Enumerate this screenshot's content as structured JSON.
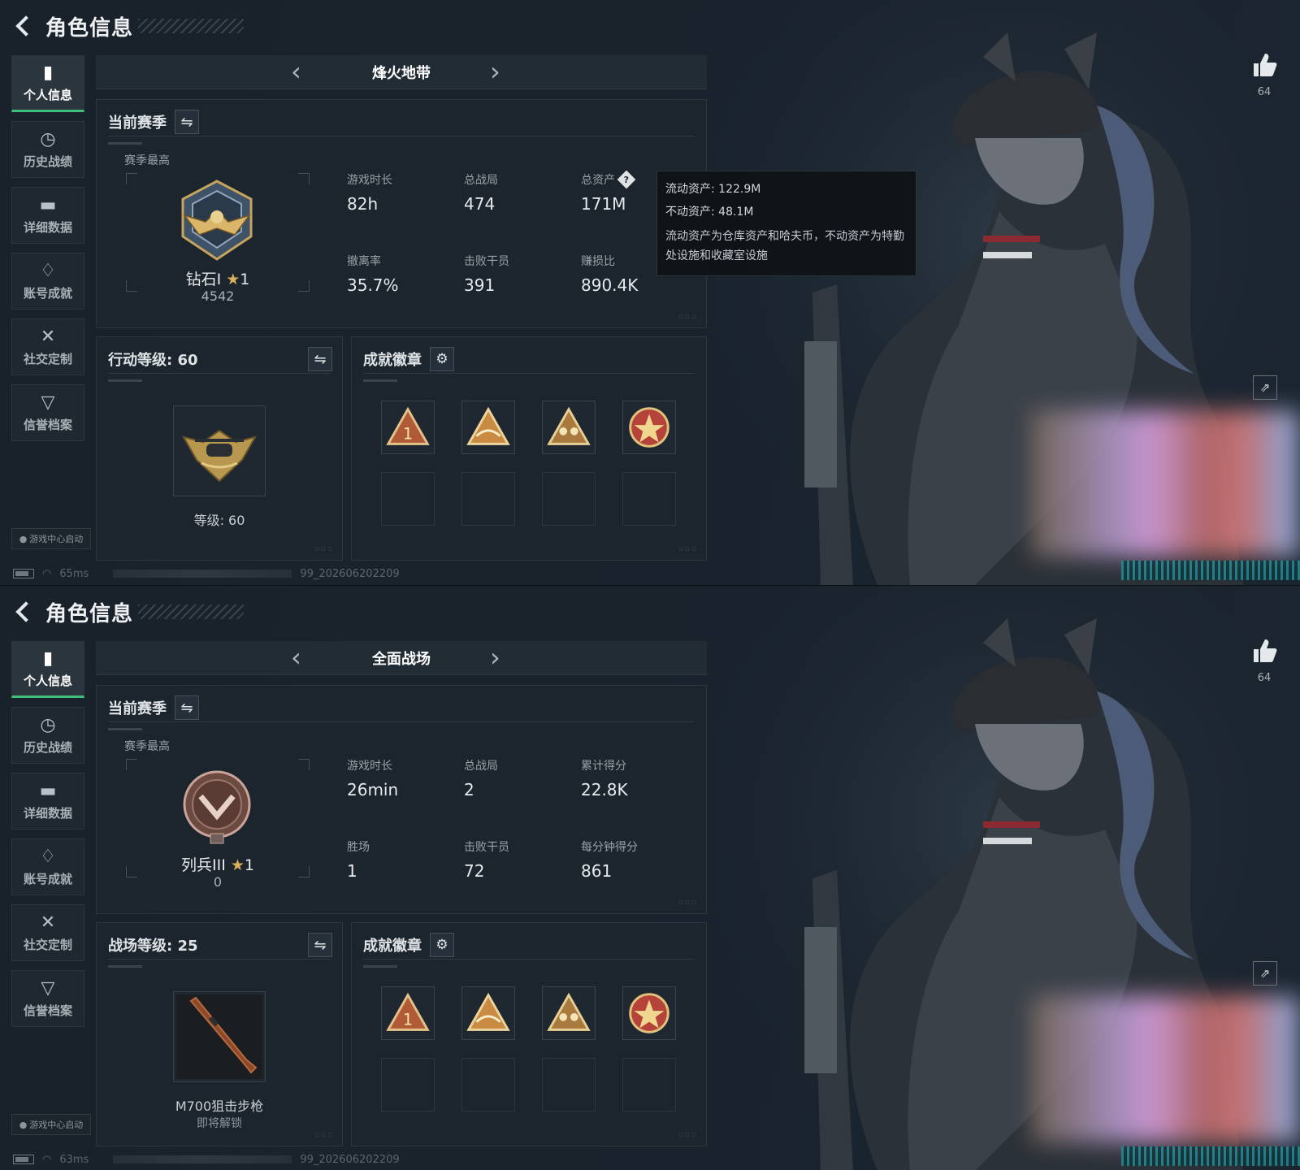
{
  "screens": [
    {
      "header": {
        "title": "角色信息"
      },
      "nav": [
        {
          "label": "个人信息",
          "icon": "bar-chart-icon"
        },
        {
          "label": "历史战绩",
          "icon": "clock-icon"
        },
        {
          "label": "详细数据",
          "icon": "folder-icon"
        },
        {
          "label": "账号成就",
          "icon": "trophy-icon"
        },
        {
          "label": "社交定制",
          "icon": "tools-icon"
        },
        {
          "label": "信誉档案",
          "icon": "shield-icon"
        }
      ],
      "launch_label": "游戏中心启动",
      "status": {
        "ping": "65ms",
        "version": "99_202606202209"
      },
      "mode": "烽火地带",
      "season": {
        "title": "当前赛季",
        "best_label": "赛季最高",
        "rank_name": "钻石I",
        "rank_stars": "1",
        "rank_points": "4542",
        "stats": [
          {
            "key": "游戏时长",
            "value": "82h"
          },
          {
            "key": "总战局",
            "value": "474"
          },
          {
            "key": "总资产",
            "value": "171M",
            "help": "?"
          },
          {
            "key": "撤离率",
            "value": "35.7%"
          },
          {
            "key": "击败干员",
            "value": "391"
          },
          {
            "key": "赚损比",
            "value": "890.4K"
          }
        ]
      },
      "level": {
        "title": "行动等级: 60",
        "caption": "等级: 60",
        "sub": ""
      },
      "achievements": {
        "title": "成就徽章"
      },
      "tooltip": {
        "line1": "流动资产: 122.9M",
        "line2": "不动资产: 48.1M",
        "note": "流动资产为仓库资产和哈夫币，不动资产为特勤处设施和收藏室设施"
      },
      "likes": "64"
    },
    {
      "header": {
        "title": "角色信息"
      },
      "nav": [
        {
          "label": "个人信息",
          "icon": "bar-chart-icon"
        },
        {
          "label": "历史战绩",
          "icon": "clock-icon"
        },
        {
          "label": "详细数据",
          "icon": "folder-icon"
        },
        {
          "label": "账号成就",
          "icon": "trophy-icon"
        },
        {
          "label": "社交定制",
          "icon": "tools-icon"
        },
        {
          "label": "信誉档案",
          "icon": "shield-icon"
        }
      ],
      "launch_label": "游戏中心启动",
      "status": {
        "ping": "63ms",
        "version": "99_202606202209"
      },
      "mode": "全面战场",
      "season": {
        "title": "当前赛季",
        "best_label": "赛季最高",
        "rank_name": "列兵III",
        "rank_stars": "1",
        "rank_points": "0",
        "stats": [
          {
            "key": "游戏时长",
            "value": "26min"
          },
          {
            "key": "总战局",
            "value": "2"
          },
          {
            "key": "累计得分",
            "value": "22.8K"
          },
          {
            "key": "胜场",
            "value": "1"
          },
          {
            "key": "击败干员",
            "value": "72"
          },
          {
            "key": "每分钟得分",
            "value": "861"
          }
        ]
      },
      "level": {
        "title": "战场等级: 25",
        "caption": "M700狙击步枪",
        "sub": "即将解锁"
      },
      "achievements": {
        "title": "成就徽章"
      },
      "likes": "64"
    }
  ],
  "colors": {
    "accent_green": "#3fc07a",
    "gold": "#d8b25a"
  }
}
